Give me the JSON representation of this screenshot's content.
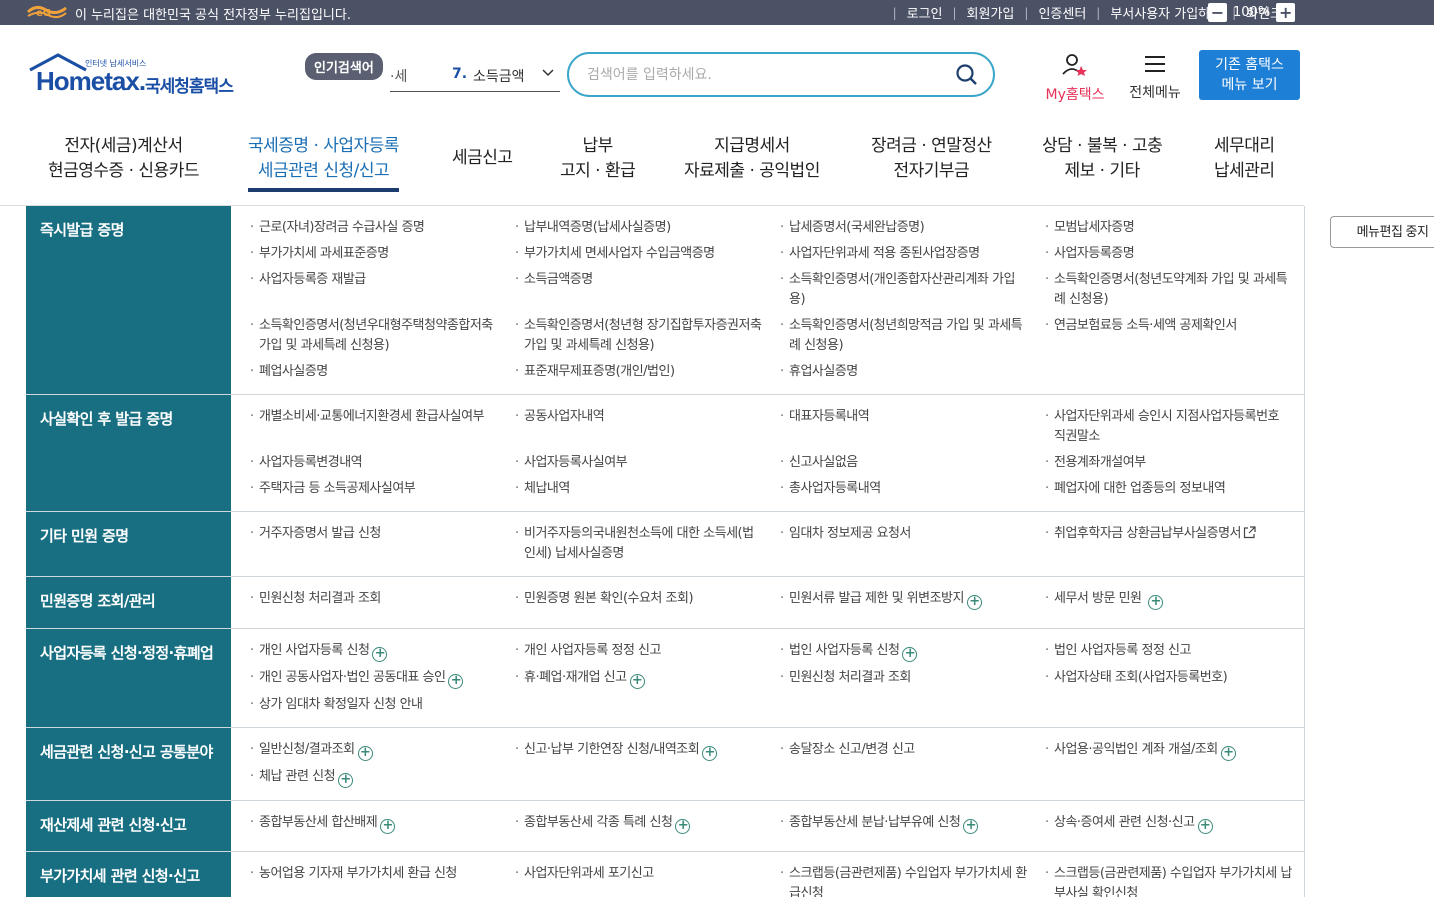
{
  "gov_bar": {
    "text": "이 누리집은 대한민국 공식 전자정부 누리집입니다.",
    "links": [
      "로그인",
      "회원가입",
      "인증센터",
      "부서사용자 가입하기",
      "화면크기"
    ],
    "zoom": "100%"
  },
  "logo": {
    "en": "Hometax.",
    "kr": "국세청홈택스",
    "sub": "인터넷 납세서비스"
  },
  "search": {
    "hot_label": "인기검색어",
    "prev_keyword": "·세",
    "rank": "7.",
    "keyword": "소득금액",
    "placeholder": "검색어를 입력하세요."
  },
  "header": {
    "my_hometax": "My홈택스",
    "all_menu": "전체메뉴",
    "old_home_line1": "기존 홈택스",
    "old_home_line2": "메뉴 보기"
  },
  "gnb": [
    {
      "l1": "전자(세금)계산서",
      "l2": "현금영수증 · 신용카드"
    },
    {
      "l1": "국세증명 · 사업자등록",
      "l2": "세금관련 신청/신고"
    },
    {
      "l1": "세금신고",
      "l2": ""
    },
    {
      "l1": "납부",
      "l2": "고지 · 환급"
    },
    {
      "l1": "지급명세서",
      "l2": "자료제출 · 공익법인"
    },
    {
      "l1": "장려금 · 연말정산",
      "l2": "전자기부금"
    },
    {
      "l1": "상담 · 불복 · 고충",
      "l2": "제보 · 기타"
    },
    {
      "l1": "세무대리",
      "l2": "납세관리"
    }
  ],
  "edit_stop": "메뉴편집 중지",
  "rows": [
    {
      "category": "즉시발급 증명",
      "items": [
        "근로(자녀)장려금 수급사실 증명",
        "납부내역증명(납세사실증명)",
        "납세증명서(국세완납증명)",
        "모범납세자증명",
        "부가가치세 과세표준증명",
        "부가가치세 면세사업자 수입금액증명",
        "사업자단위과세 적용 종된사업장증명",
        "사업자등록증명",
        "사업자등록증 재발급",
        "소득금액증명",
        "소득확인증명서(개인종합자산관리계좌 가입용)",
        "소득확인증명서(청년도약계좌 가입 및 과세특례 신청용)",
        "소득확인증명서(청년우대형주택청약종합저축 가입 및 과세특례 신청용)",
        "소득확인증명서(청년형 장기집합투자증권저축 가입 및 과세특례 신청용)",
        "소득확인증명서(청년희망적금 가입 및 과세특례 신청용)",
        "연금보험료등 소득·세액 공제확인서",
        "폐업사실증명",
        "표준재무제표증명(개인/법인)",
        "휴업사실증명"
      ]
    },
    {
      "category": "사실확인 후 발급 증명",
      "items": [
        "개별소비세·교통에너지환경세 환급사실여부",
        "공동사업자내역",
        "대표자등록내역",
        "사업자단위과세 승인시 지점사업자등록번호 직권말소",
        "사업자등록변경내역",
        "사업자등록사실여부",
        "신고사실없음",
        "전용계좌개설여부",
        "주택자금 등 소득공제사실여부",
        "체납내역",
        "총사업자등록내역",
        "폐업자에 대한 업종등의 정보내역"
      ]
    },
    {
      "category": "기타 민원 증명",
      "items": [
        "거주자증명서 발급 신청",
        "비거주자등의국내원천소득에 대한 소득세(법인세) 납세사실증명",
        "임대차 정보제공 요청서",
        "취업후학자금 상환금납부사실증명서"
      ]
    },
    {
      "category": "민원증명 조회/관리",
      "items": [
        "민원신청 처리결과 조회",
        "민원증명 원본 확인(수요처 조회)",
        "민원서류 발급 제한 및 위변조방지",
        "세무서 방문 민원"
      ]
    },
    {
      "category": "사업자등록 신청·정정·휴폐업",
      "items": [
        "개인 사업자등록 신청",
        "개인 사업자등록 정정 신고",
        "법인 사업자등록 신청",
        "법인 사업자등록 정정 신고",
        "개인 공동사업자·법인 공동대표 승인",
        "휴·폐업·재개업 신고",
        "민원신청 처리결과 조회",
        "사업자상태 조회(사업자등록번호)",
        "상가 임대차 확정일자 신청 안내"
      ]
    },
    {
      "category": "세금관련 신청·신고 공통분야",
      "items": [
        "일반신청/결과조회",
        "신고·납부 기한연장 신청/내역조회",
        "송달장소 신고/변경 신고",
        "사업용·공익법인 계좌 개설/조회",
        "체납 관련 신청"
      ]
    },
    {
      "category": "재산제세 관련 신청·신고",
      "items": [
        "종합부동산세 합산배제",
        "종합부동산세 각종 특례 신청",
        "종합부동산세 분납·납부유예 신청",
        "상속·증여세 관련 신청·신고"
      ]
    },
    {
      "category": "부가가치세 관련 신청·신고",
      "items": [
        "농어업용 기자재 부가가치세 환급 신청",
        "사업자단위과세 포기신고",
        "스크랩등(금관련제품) 수입업자 부가가치세 환급신청",
        "스크랩등(금관련제품) 수입업자 부가가치세 납부사실 확인신청"
      ]
    }
  ]
}
